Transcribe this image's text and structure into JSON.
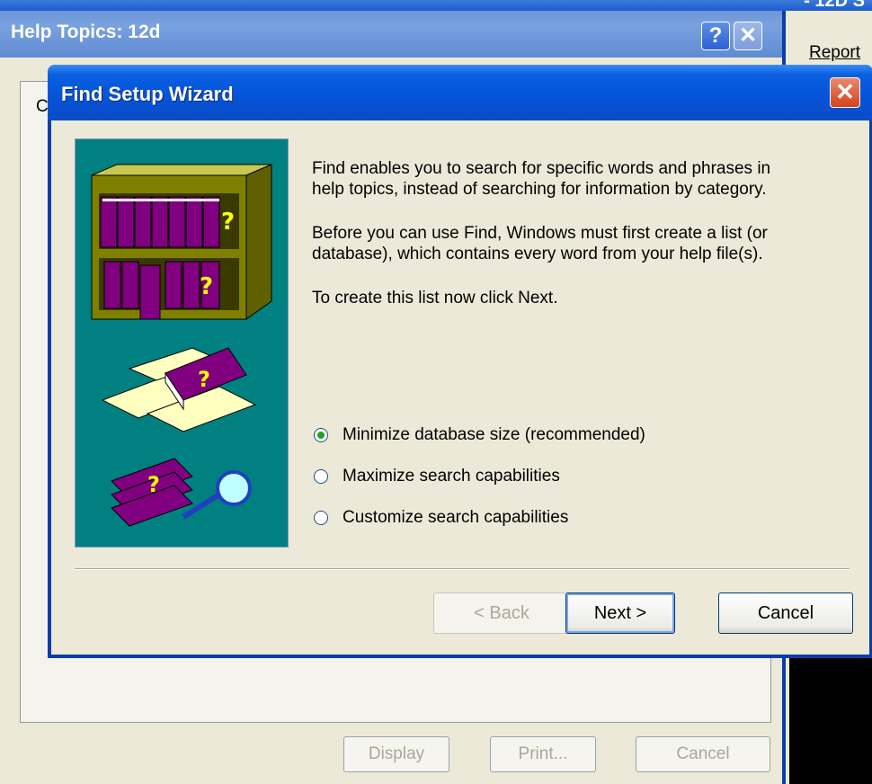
{
  "background_app": {
    "title_fragment": "- 12D S",
    "report_menu": "Report"
  },
  "help_window": {
    "title": "Help Topics: 12d",
    "help_button": "?",
    "close_button": "✕",
    "tab_label": "C",
    "buttons": {
      "display": "Display",
      "print": "Print...",
      "cancel": "Cancel"
    }
  },
  "wizard": {
    "title": "Find Setup Wizard",
    "close_button": "✕",
    "paragraphs": [
      "Find enables you to search for specific words and phrases in help topics, instead of searching for information by category.",
      "Before you can use Find, Windows must first create a list (or database), which contains every word from your help file(s).",
      "To create this list now click Next."
    ],
    "options": [
      {
        "label": "Minimize database size (recommended)",
        "checked": true
      },
      {
        "label": "Maximize search capabilities",
        "checked": false
      },
      {
        "label": "Customize search capabilities",
        "checked": false
      }
    ],
    "buttons": {
      "back": "< Back",
      "next": "Next >",
      "cancel": "Cancel"
    }
  },
  "colors": {
    "xp_blue": "#0553d8",
    "art_teal": "#008080",
    "book_purple": "#800080",
    "shelf_olive": "#808000"
  }
}
